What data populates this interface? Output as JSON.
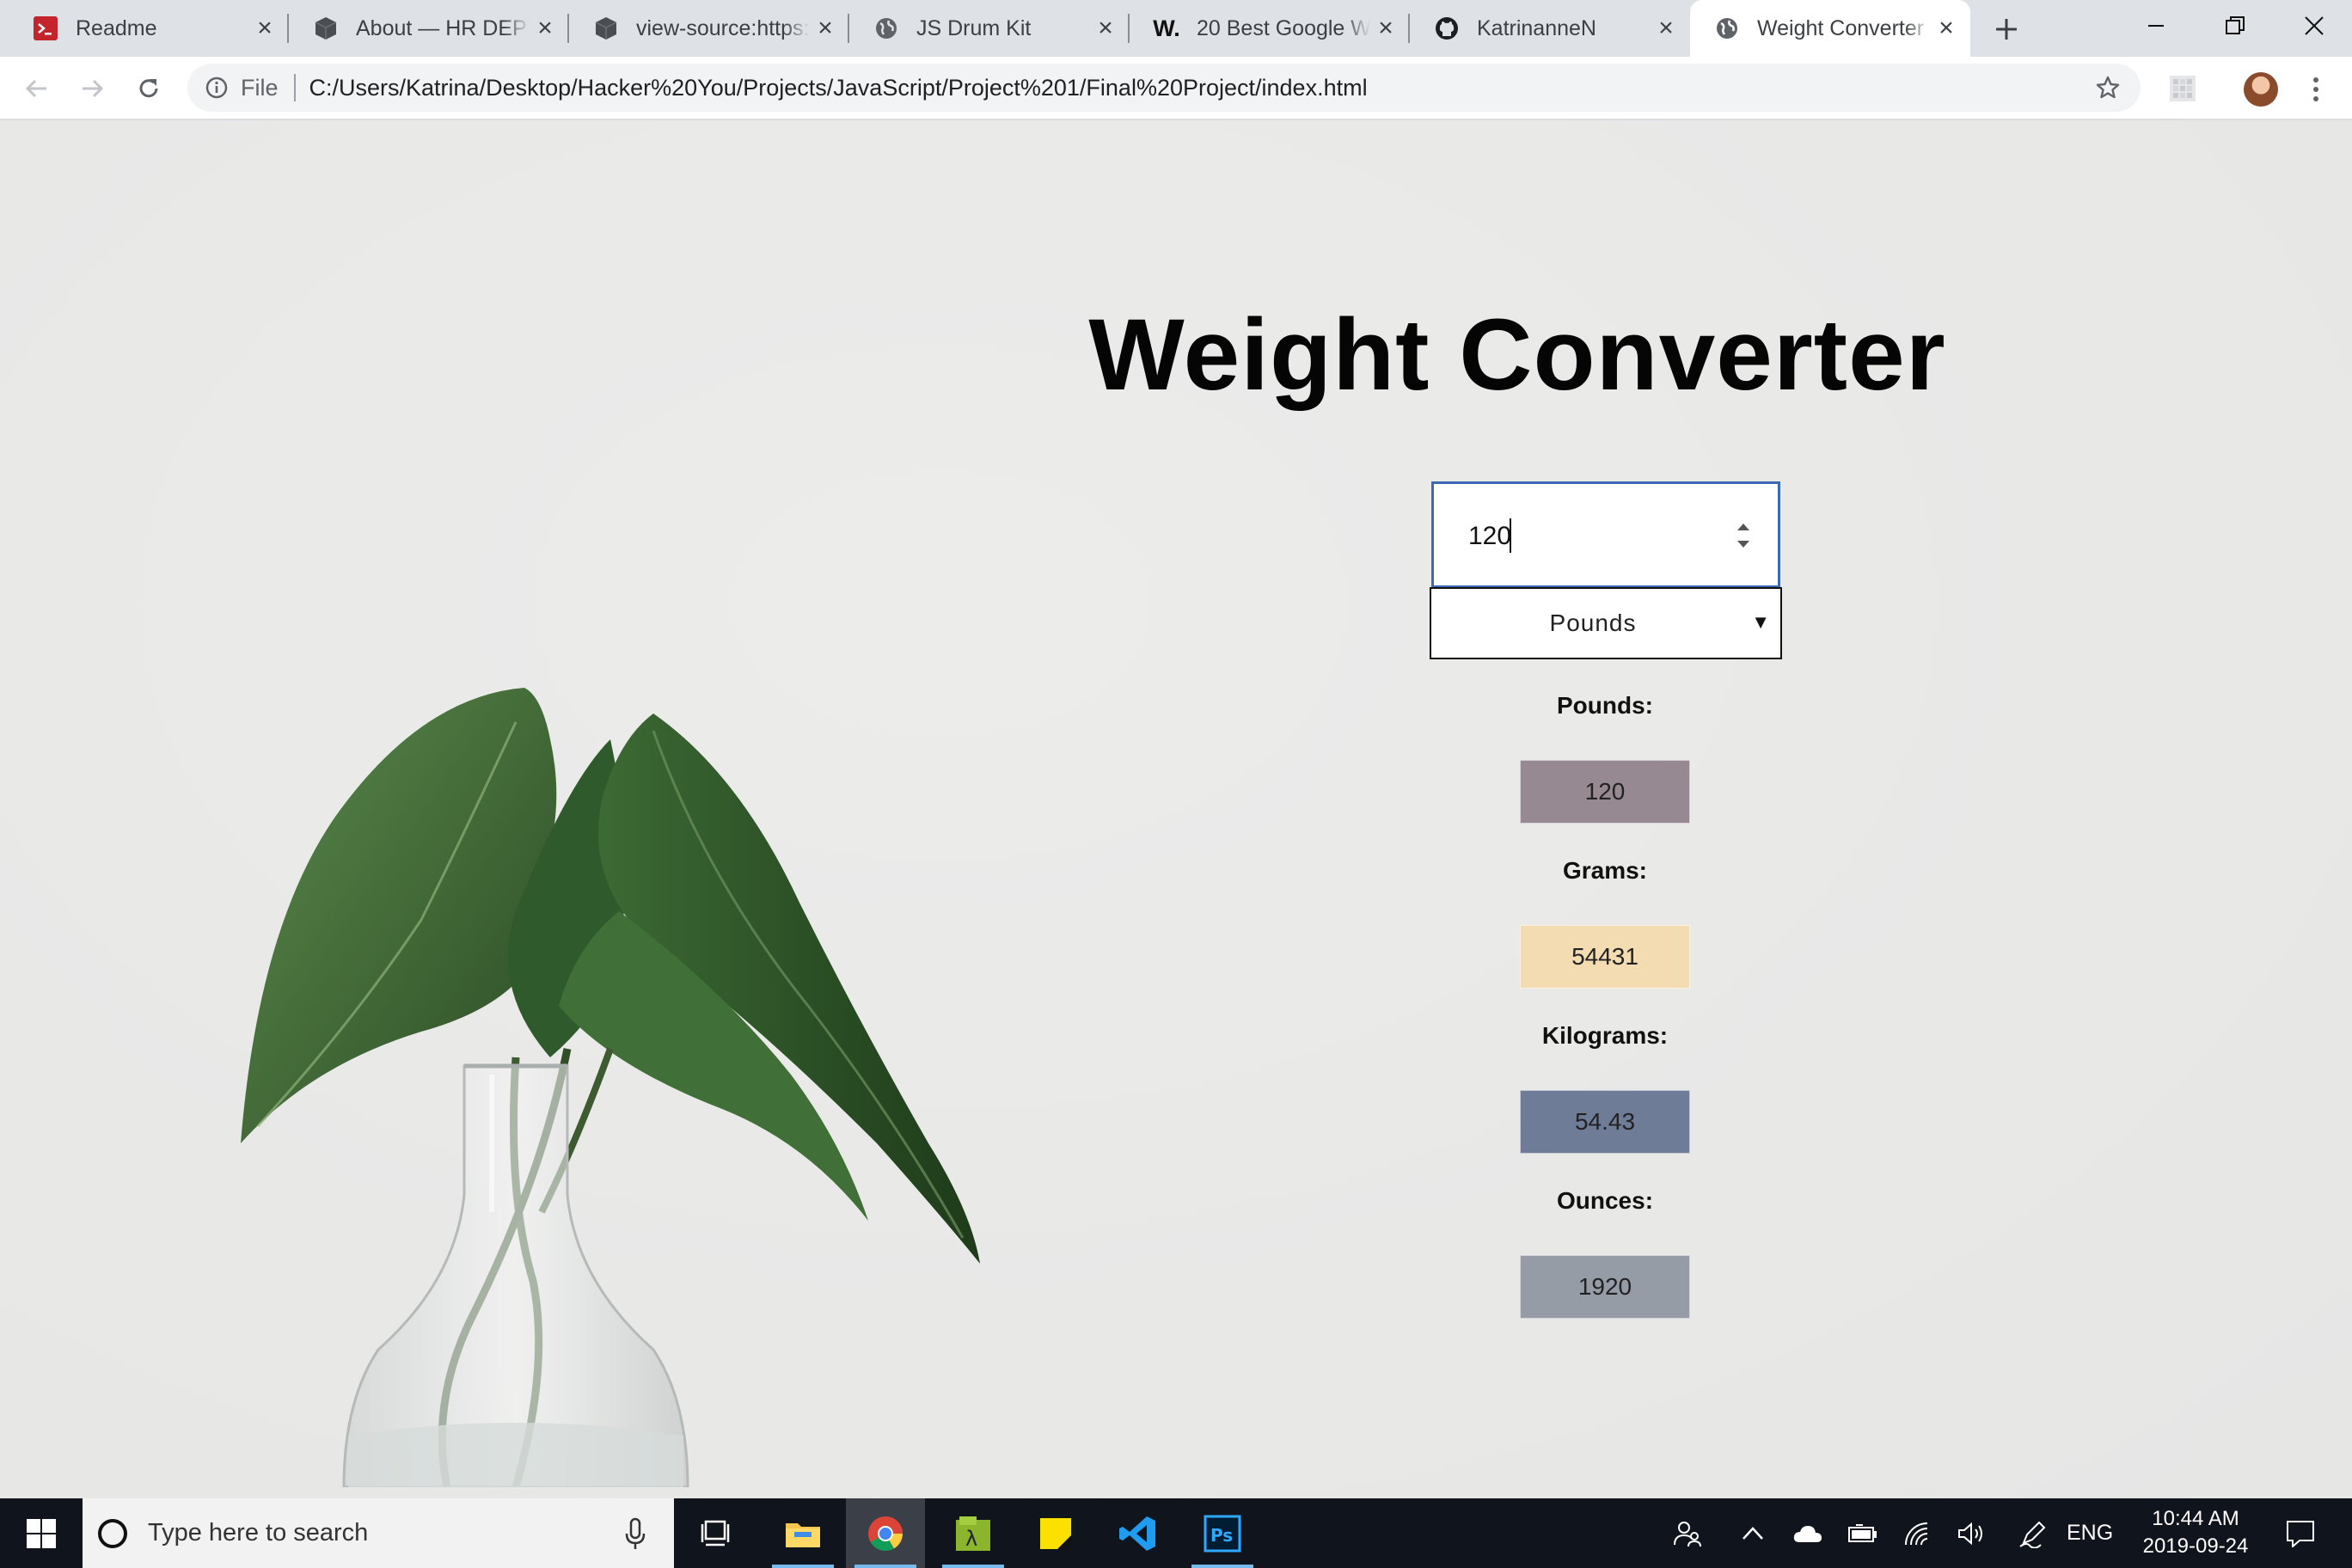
{
  "browser": {
    "tabs": [
      {
        "title": "Readme",
        "favicon": "terminal-red-icon"
      },
      {
        "title": "About — HR DEPT",
        "favicon": "cube-icon"
      },
      {
        "title": "view-source:https:",
        "favicon": "cube-icon"
      },
      {
        "title": "JS Drum Kit",
        "favicon": "globe-icon"
      },
      {
        "title": "20 Best Google W",
        "favicon": "w-logo-icon"
      },
      {
        "title": "KatrinanneN",
        "favicon": "github-icon"
      },
      {
        "title": "Weight Converter",
        "favicon": "globe-icon",
        "active": true
      }
    ],
    "address": {
      "scheme_label": "File",
      "url": "C:/Users/Katrina/Desktop/Hacker%20You/Projects/JavaScript/Project%201/Final%20Project/index.html"
    }
  },
  "page": {
    "title": "Weight Converter",
    "input_value": "120",
    "unit_select": {
      "selected": "Pounds"
    },
    "results": [
      {
        "label": "Pounds:",
        "value": "120",
        "color": "#978991"
      },
      {
        "label": "Grams:",
        "value": "54431",
        "color": "#f3dbb2"
      },
      {
        "label": "Kilograms:",
        "value": "54.43",
        "color": "#6f7c97"
      },
      {
        "label": "Ounces:",
        "value": "1920",
        "color": "#959ca5"
      }
    ]
  },
  "taskbar": {
    "search_placeholder": "Type here to search",
    "language": "ENG",
    "time": "10:44 AM",
    "date": "2019-09-24"
  }
}
